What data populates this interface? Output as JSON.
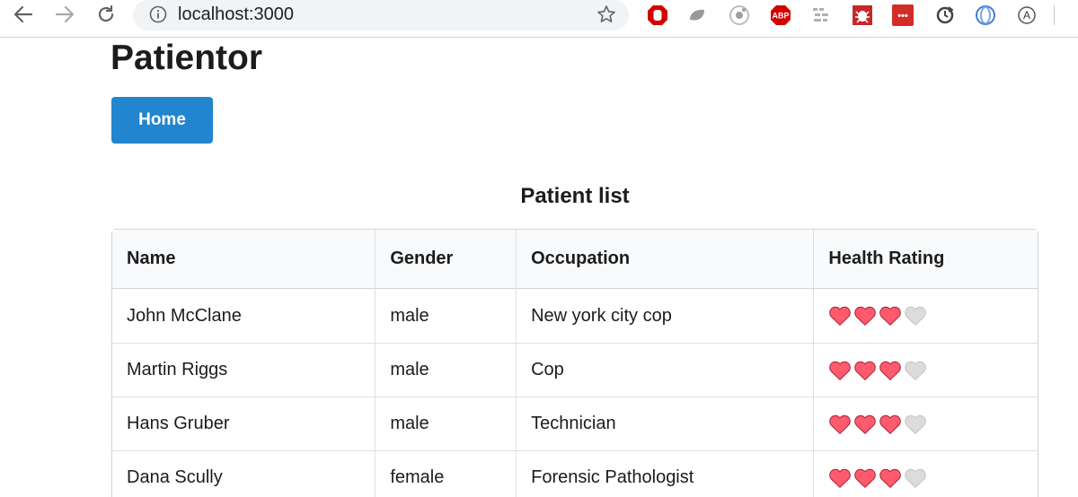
{
  "browser": {
    "url": "localhost:3000",
    "icons": {
      "back": "back-arrow-icon",
      "forward": "forward-arrow-icon",
      "reload": "reload-icon",
      "info": "info-icon",
      "bookmark": "star-icon"
    },
    "extensions": [
      {
        "name": "ublock-icon"
      },
      {
        "name": "leaf-extension-icon"
      },
      {
        "name": "circle-extension-icon"
      },
      {
        "name": "adblock-plus-icon",
        "label": "ABP"
      },
      {
        "name": "grid-extension-icon"
      },
      {
        "name": "bug-extension-icon"
      },
      {
        "name": "lastpass-icon",
        "label": "•••"
      },
      {
        "name": "clock-extension-icon"
      },
      {
        "name": "ring-extension-icon"
      },
      {
        "name": "a-extension-icon",
        "label": "A"
      }
    ]
  },
  "app": {
    "title": "Patientor",
    "home_label": "Home"
  },
  "patient_list": {
    "heading": "Patient list",
    "columns": [
      "Name",
      "Gender",
      "Occupation",
      "Health Rating"
    ],
    "max_rating": 4,
    "colors": {
      "heart_filled": "#ff5a6e",
      "heart_empty": "#dcdcdc"
    },
    "rows": [
      {
        "name": "John McClane",
        "gender": "male",
        "occupation": "New york city cop",
        "rating": 3
      },
      {
        "name": "Martin Riggs",
        "gender": "male",
        "occupation": "Cop",
        "rating": 3
      },
      {
        "name": "Hans Gruber",
        "gender": "male",
        "occupation": "Technician",
        "rating": 3
      },
      {
        "name": "Dana Scully",
        "gender": "female",
        "occupation": "Forensic Pathologist",
        "rating": 3
      }
    ]
  }
}
